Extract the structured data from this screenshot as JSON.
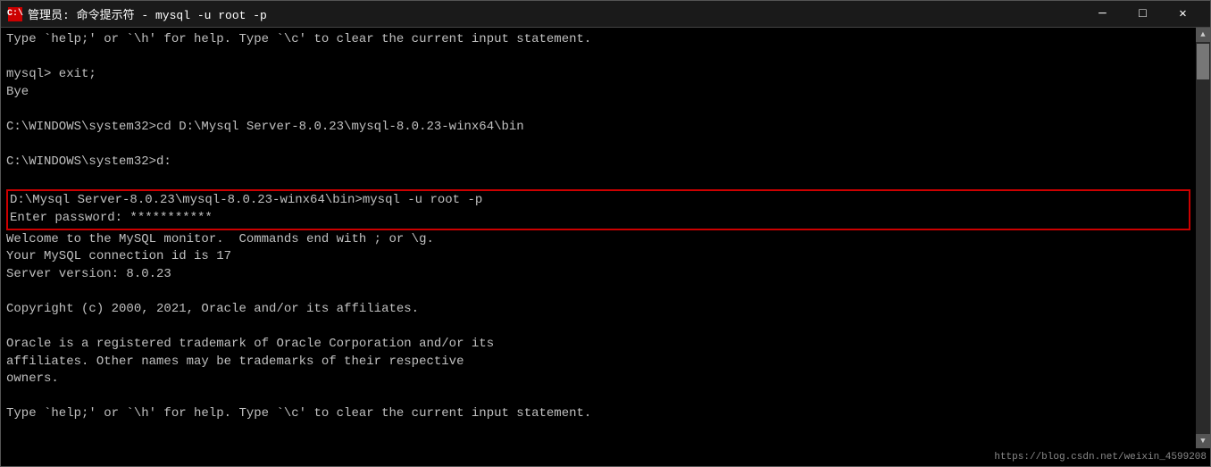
{
  "titleBar": {
    "iconLabel": "C:\\",
    "title": "管理员: 命令提示符 - mysql  -u root -p",
    "minimizeLabel": "─",
    "maximizeLabel": "□",
    "closeLabel": "✕"
  },
  "terminal": {
    "lines": [
      {
        "id": "line1",
        "text": "Type `help;' or `\\h' for help. Type `\\c' to clear the current input statement.",
        "highlight": false
      },
      {
        "id": "line2",
        "text": "",
        "highlight": false
      },
      {
        "id": "line3",
        "text": "mysql> exit;",
        "highlight": false
      },
      {
        "id": "line4",
        "text": "Bye",
        "highlight": false
      },
      {
        "id": "line5",
        "text": "",
        "highlight": false
      },
      {
        "id": "line6",
        "text": "C:\\WINDOWS\\system32>cd D:\\Mysql Server-8.0.23\\mysql-8.0.23-winx64\\bin",
        "highlight": false
      },
      {
        "id": "line7",
        "text": "",
        "highlight": false
      },
      {
        "id": "line8",
        "text": "C:\\WINDOWS\\system32>d:",
        "highlight": false
      },
      {
        "id": "line9",
        "text": "",
        "highlight": false
      },
      {
        "id": "line10",
        "text": "D:\\Mysql Server-8.0.23\\mysql-8.0.23-winx64\\bin>mysql -u root -p",
        "highlight": true
      },
      {
        "id": "line11",
        "text": "Enter password: ***********",
        "highlight": true
      },
      {
        "id": "line12",
        "text": "Welcome to the MySQL monitor.  Commands end with ; or \\g.",
        "highlight": false
      },
      {
        "id": "line13",
        "text": "Your MySQL connection id is 17",
        "highlight": false
      },
      {
        "id": "line14",
        "text": "Server version: 8.0.23",
        "highlight": false
      },
      {
        "id": "line15",
        "text": "",
        "highlight": false
      },
      {
        "id": "line16",
        "text": "Copyright (c) 2000, 2021, Oracle and/or its affiliates.",
        "highlight": false
      },
      {
        "id": "line17",
        "text": "",
        "highlight": false
      },
      {
        "id": "line18",
        "text": "Oracle is a registered trademark of Oracle Corporation and/or its",
        "highlight": false
      },
      {
        "id": "line19",
        "text": "affiliates. Other names may be trademarks of their respective",
        "highlight": false
      },
      {
        "id": "line20",
        "text": "owners.",
        "highlight": false
      },
      {
        "id": "line21",
        "text": "",
        "highlight": false
      },
      {
        "id": "line22",
        "text": "Type `help;' or `\\h' for help. Type `\\c' to clear the current input statement.",
        "highlight": false
      }
    ]
  },
  "bottomBar": {
    "url": "https://blog.csdn.net/weixin_4599208"
  }
}
